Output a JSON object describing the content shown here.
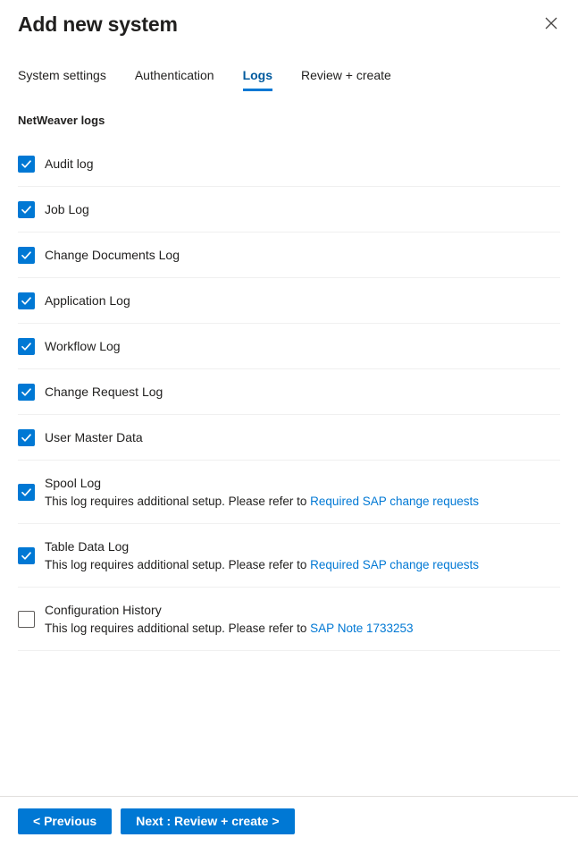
{
  "panel": {
    "title": "Add new system",
    "close_icon": "close-icon"
  },
  "tabs": [
    {
      "label": "System settings",
      "active": false
    },
    {
      "label": "Authentication",
      "active": false
    },
    {
      "label": "Logs",
      "active": true
    },
    {
      "label": "Review + create",
      "active": false
    }
  ],
  "section": {
    "title": "NetWeaver logs"
  },
  "logs": [
    {
      "label": "Audit log",
      "checked": true,
      "desc": "",
      "link": ""
    },
    {
      "label": "Job Log",
      "checked": true,
      "desc": "",
      "link": ""
    },
    {
      "label": "Change Documents Log",
      "checked": true,
      "desc": "",
      "link": ""
    },
    {
      "label": "Application Log",
      "checked": true,
      "desc": "",
      "link": ""
    },
    {
      "label": "Workflow Log",
      "checked": true,
      "desc": "",
      "link": ""
    },
    {
      "label": "Change Request Log",
      "checked": true,
      "desc": "",
      "link": ""
    },
    {
      "label": "User Master Data",
      "checked": true,
      "desc": "",
      "link": ""
    },
    {
      "label": "Spool Log",
      "checked": true,
      "desc": "This log requires additional setup. Please refer to ",
      "link": "Required SAP change requests"
    },
    {
      "label": "Table Data Log",
      "checked": true,
      "desc": "This log requires additional setup. Please refer to ",
      "link": "Required SAP change requests"
    },
    {
      "label": "Configuration History",
      "checked": false,
      "desc": "This log requires additional setup. Please refer to ",
      "link": "SAP Note 1733253"
    }
  ],
  "footer": {
    "previous_label": "< Previous",
    "next_label": "Next : Review + create >"
  },
  "colors": {
    "accent": "#0078d4",
    "link": "#0078d4",
    "text": "#201f1e",
    "divider": "#f0f0f0",
    "footer_divider": "#e1dfdd"
  }
}
